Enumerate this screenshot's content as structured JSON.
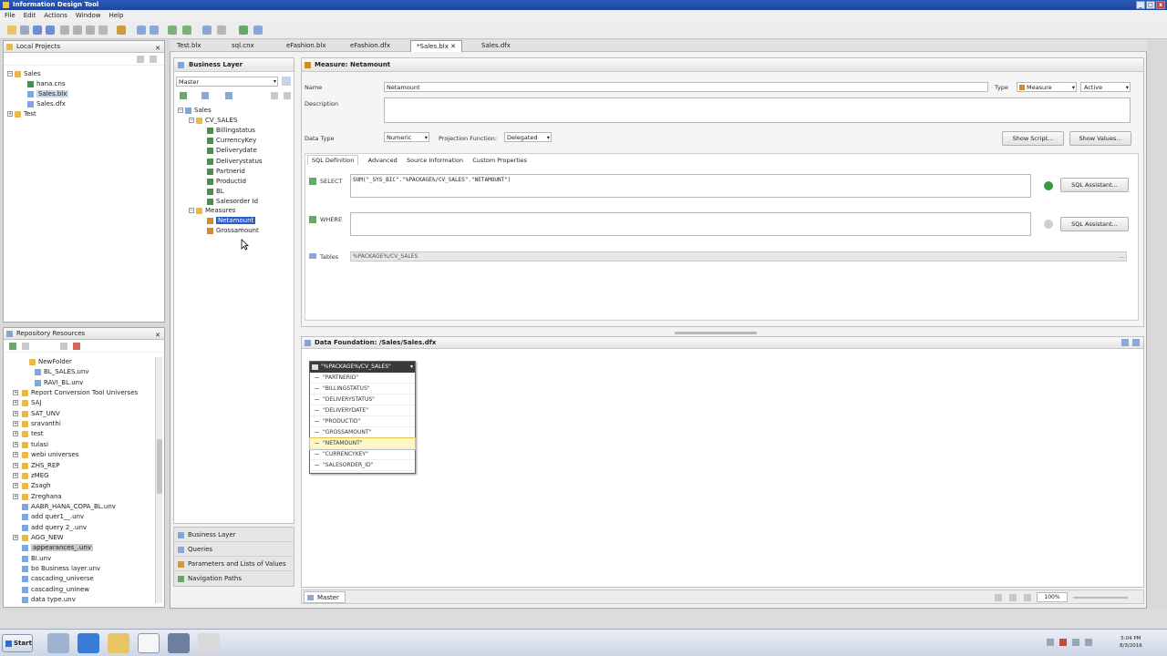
{
  "window": {
    "title": "Information Design Tool"
  },
  "menu": [
    "File",
    "Edit",
    "Actions",
    "Window",
    "Help"
  ],
  "local_projects": {
    "title": "Local Projects",
    "items": [
      {
        "label": "Sales",
        "icon": "folder-icon"
      },
      {
        "label": "hana.cns",
        "icon": "connection-icon"
      },
      {
        "label": "Sales.blx",
        "icon": "business-layer-icon",
        "selected": true
      },
      {
        "label": "Sales.dfx",
        "icon": "data-foundation-icon"
      },
      {
        "label": "Test",
        "icon": "folder-icon"
      }
    ]
  },
  "repository": {
    "title": "Repository Resources",
    "items": [
      "NewFolder",
      "BL_SALES.unv",
      "RAVI_BL.unv",
      "Report Conversion Tool Universes",
      "SAJ",
      "SAT_UNV",
      "sravanthi",
      "test",
      "tulasi",
      "webi universes",
      "ZHS_REP",
      "zMEG",
      "Zsagh",
      "Zreghana",
      "AABR_HANA_COPA_BL.unv",
      "add quer1__.unv",
      "add query 2_.unv",
      "AGG_NEW",
      "appearances_.unv",
      "BI.unv",
      "bo Business layer.unv",
      "cascading_universe",
      "cascading_uninew",
      "data type.unv"
    ]
  },
  "editor_tabs": [
    {
      "label": "Test.blx"
    },
    {
      "label": "sql.cnx"
    },
    {
      "label": "eFashion.blx"
    },
    {
      "label": "eFashion.dfx"
    },
    {
      "label": "*Sales.blx",
      "active": true
    },
    {
      "label": "Sales.dfx"
    }
  ],
  "business_layer": {
    "title": "Business Layer",
    "view": "Master",
    "tree": {
      "root": "Sales",
      "folder": "CV_SALES",
      "dimensions": [
        "Billingstatus",
        "CurrencyKey",
        "Deliverydate",
        "Deliverystatus",
        "Partnerid",
        "Productid",
        "BL",
        "Salesorder Id"
      ],
      "measures_folder": "Measures",
      "measures": [
        "Netamount",
        "Grossamount"
      ]
    },
    "bottom_nav": [
      "Business Layer",
      "Queries",
      "Parameters and Lists of Values",
      "Navigation Paths"
    ]
  },
  "measure": {
    "header": "Measure: Netamount",
    "name_label": "Name",
    "name_value": "Netamount",
    "type_label": "Type",
    "type_value": "Measure",
    "state_value": "Active",
    "description_label": "Description",
    "datatype_label": "Data Type",
    "datatype_value": "Numeric",
    "projection_label": "Projection Function:",
    "projection_value": "Delegated",
    "show_script": "Show Script...",
    "show_values": "Show Values...",
    "tabs": [
      "SQL Definition",
      "Advanced",
      "Source Information",
      "Custom Properties"
    ],
    "select_label": "SELECT",
    "select_value": "SUM(\"_SYS_BIC\".\"%PACKAGE%/CV_SALES\".\"NETAMOUNT\")",
    "where_label": "WHERE",
    "sql_assistant": "SQL Assistant...",
    "tables_label": "Tables",
    "tables_value": "%PACKAGE%/CV_SALES"
  },
  "data_foundation": {
    "title": "Data Foundation: /Sales/Sales.dfx",
    "table_name": "\"%PACKAGE%/CV_SALES\"",
    "columns": [
      "\"PARTNERID\"",
      "\"BILLINGSTATUS\"",
      "\"DELIVERYSTATUS\"",
      "\"DELIVERYDATE\"",
      "\"PRODUCTID\"",
      "\"GROSSAMOUNT\"",
      "\"NETAMOUNT\"",
      "\"CURRENCYKEY\"",
      "\"SALESORDER_ID\""
    ],
    "highlighted_column": "\"NETAMOUNT\"",
    "bottom_tab": "Master",
    "zoom": "100%"
  },
  "taskbar": {
    "start": "Start",
    "time": "5:04 PM",
    "date": "8/3/2016"
  }
}
